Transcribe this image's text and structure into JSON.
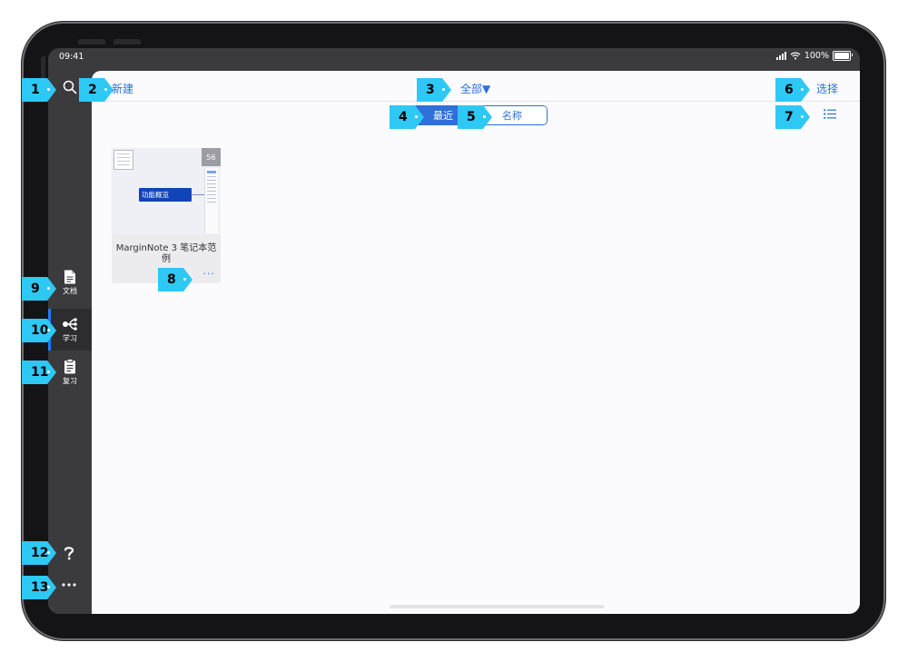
{
  "status": {
    "time": "09:41",
    "battery": "100%",
    "battery_level": 1.0
  },
  "header": {
    "new_label": "新建",
    "filter_label": "全部▼",
    "select_label": "选择"
  },
  "sort": {
    "recent": "最近",
    "name": "名称",
    "selected": "recent"
  },
  "notebook": {
    "title": "MarginNote 3 笔记本范例",
    "badge": "56",
    "node_label": "功能概览",
    "more": "···"
  },
  "nav": {
    "documents": "文档",
    "study": "学习",
    "review": "复习",
    "active": "study"
  },
  "icons": {
    "search": "search-icon",
    "list": "list-view-icon",
    "document": "document-icon",
    "study": "mindmap-icon",
    "review": "clipboard-icon",
    "help": "help-icon",
    "more": "more-icon"
  },
  "callouts": [
    "1",
    "2",
    "3",
    "4",
    "5",
    "6",
    "7",
    "8",
    "9",
    "10",
    "11",
    "12",
    "13"
  ],
  "colors": {
    "accent": "#2e6fd8",
    "callout": "#2ec8f5",
    "sidebar": "#3b3b3e",
    "active_marker": "#1f7cf6"
  }
}
